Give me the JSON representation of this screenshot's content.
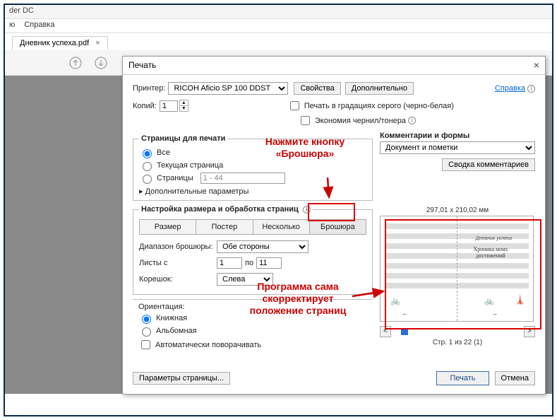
{
  "app": {
    "title_fragment": "der DC"
  },
  "menu": {
    "item1_frag": "ю",
    "item2": "Справка"
  },
  "tab": {
    "name": "Дневник успеха.pdf"
  },
  "dialog": {
    "title": "Печать",
    "printer_label": "Принтер:",
    "printer_value": "RICOH Aficio SP 100 DDST",
    "properties_btn": "Свойства",
    "advanced_btn": "Дополнительно",
    "help_link": "Справка",
    "copies_label": "Копий:",
    "copies_value": "1",
    "grayscale_label": "Печать в градациях серого (черно-белая)",
    "ink_label": "Экономия чернил/тонера",
    "pages_group": "Страницы для печати",
    "pages_opt_all": "Все",
    "pages_opt_current": "Текущая страница",
    "pages_opt_range": "Страницы",
    "pages_range_value": "1 - 44",
    "pages_more": "Дополнительные параметры",
    "sizing_group": "Настройка размера и обработка страниц",
    "sizing_size": "Размер",
    "sizing_poster": "Постер",
    "sizing_multiple": "Несколько",
    "sizing_booklet": "Брошюра",
    "booklet_range_label": "Диапазон брошюры:",
    "booklet_range_value": "Обе стороны",
    "sheets_from_label": "Листы с",
    "sheets_from": "1",
    "sheets_to_label": "по",
    "sheets_to": "11",
    "binding_label": "Корешок:",
    "binding_value": "Слева",
    "orient_group": "Ориентация:",
    "orient_portrait": "Книжная",
    "orient_landscape": "Альбомная",
    "orient_auto": "Автоматически поворачивать",
    "comments_group": "Комментарии и формы",
    "comments_value": "Документ и пометки",
    "comments_summary_btn": "Сводка комментариев",
    "preview_dims": "297,01 x 210,02 мм",
    "page_info": "Стр. 1 из 22 (1)",
    "page_setup_btn": "Параметры страницы...",
    "print_btn": "Печать",
    "cancel_btn": "Отмена",
    "preview_text1": "Дневник успеха",
    "preview_text2": "Хроника моих достижений"
  },
  "annotations": {
    "booklet_hint": "Нажмите кнопку «Брошюра»",
    "preview_hint": "Программа сама скорректирует положение страниц"
  }
}
